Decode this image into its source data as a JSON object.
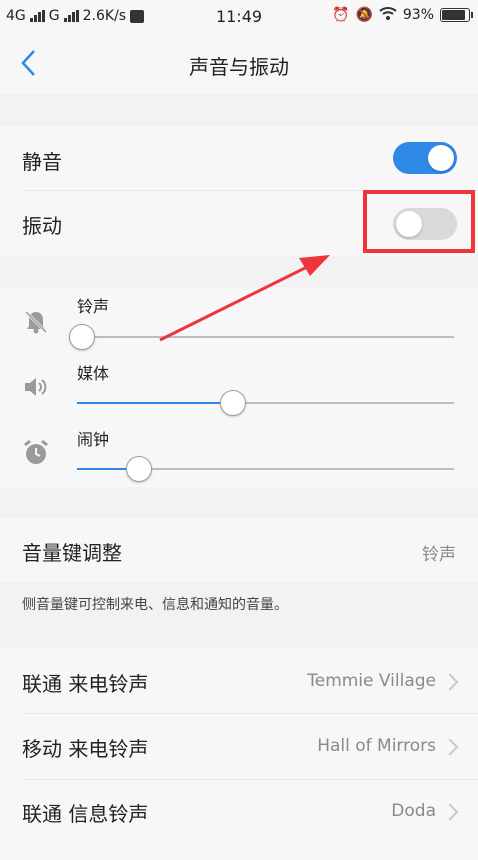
{
  "status_bar": {
    "left_text": "4G",
    "left_text_2": "G",
    "net_speed": "2.6K/s",
    "time": "11:49",
    "battery": "93%",
    "battery_level": 0.93
  },
  "header": {
    "title": "声音与振动",
    "back_icon": "chevron-left-icon"
  },
  "toggles": [
    {
      "label": "静音",
      "on": true
    },
    {
      "label": "振动",
      "on": false
    }
  ],
  "volume": [
    {
      "label": "铃声",
      "icon": "bell-muted-icon",
      "level": 0.0
    },
    {
      "label": "媒体",
      "icon": "speaker-icon",
      "level": 0.4
    },
    {
      "label": "闹钟",
      "icon": "alarm-clock-icon",
      "level": 0.15
    }
  ],
  "volume_key": {
    "label": "音量键调整",
    "value": "铃声",
    "hint": "侧音量键可控制来电、信息和通知的音量。"
  },
  "ringtones": [
    {
      "label": "联通 来电铃声",
      "value": "Temmie Village"
    },
    {
      "label": "移动 来电铃声",
      "value": "Hall of Mirrors"
    },
    {
      "label": "联通 信息铃声",
      "value": "Doda"
    }
  ],
  "colors": {
    "accent": "#2e8ae6",
    "highlight": "#f0343c",
    "background": "#f2f2f2"
  }
}
